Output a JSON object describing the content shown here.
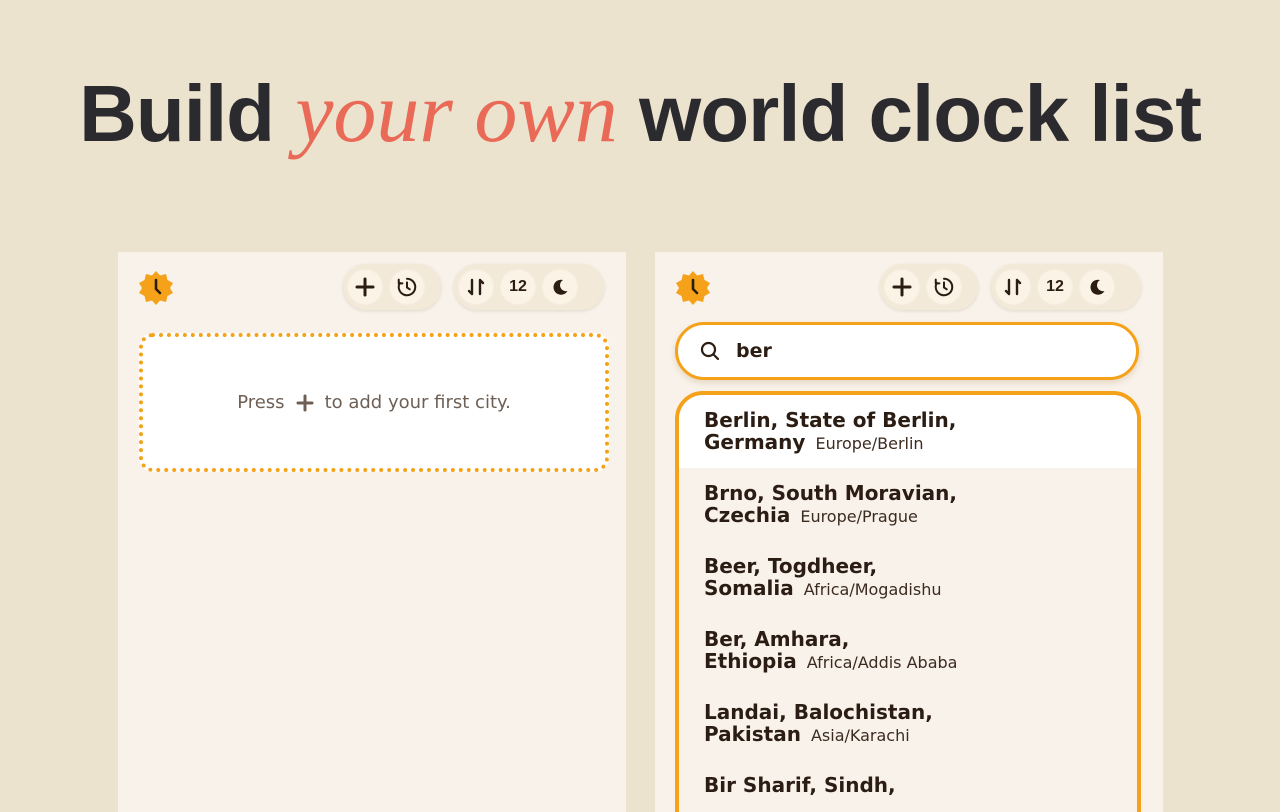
{
  "headline": {
    "before": "Build ",
    "accent": "your own",
    "after": " world clock list"
  },
  "colors": {
    "background": "#ece3cf",
    "panel": "#f8f2ea",
    "accent_orange": "#f5a21a",
    "accent_coral": "#e86a57",
    "text_dark": "#2b1d14"
  },
  "toolbar": {
    "logo_icon": "clock-badge-icon",
    "add_icon": "plus-icon",
    "timer_icon": "clock-refresh-icon",
    "sort_icon": "sort-arrows-icon",
    "format_label": "12",
    "theme_icon": "moon-icon"
  },
  "left_panel": {
    "empty": {
      "before": "Press",
      "after": "to add your first city."
    }
  },
  "right_panel": {
    "search": {
      "value": "ber"
    },
    "results": [
      {
        "line1": "Berlin, State of Berlin,",
        "line2": "Germany",
        "tz": "Europe/Berlin"
      },
      {
        "line1": "Brno, South Moravian,",
        "line2": "Czechia",
        "tz": "Europe/Prague"
      },
      {
        "line1": "Beer, Togdheer,",
        "line2": "Somalia",
        "tz": "Africa/Mogadishu"
      },
      {
        "line1": "Ber, Amhara,",
        "line2": "Ethiopia",
        "tz": "Africa/Addis Ababa"
      },
      {
        "line1": "Landai, Balochistan,",
        "line2": "Pakistan",
        "tz": "Asia/Karachi"
      },
      {
        "line1": "Bir Sharif, Sindh,",
        "line2": "",
        "tz": ""
      }
    ]
  }
}
